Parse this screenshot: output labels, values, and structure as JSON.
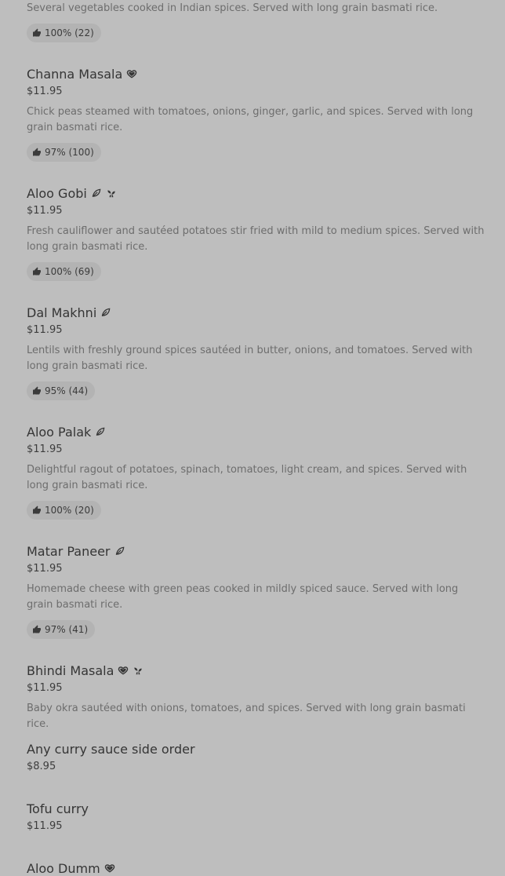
{
  "items": [
    {
      "description": "Several vegetables cooked in Indian spices. Served with long grain basmati rice.",
      "rating": "100% (22)"
    },
    {
      "name": "Channa Masala",
      "price": "$11.95",
      "description": "Chick peas steamed with tomatoes, onions, ginger, garlic, and spices. Served with long grain basmati rice.",
      "rating": "97% (100)",
      "tags": [
        "heart-icon"
      ]
    },
    {
      "name": "Aloo Gobi",
      "price": "$11.95",
      "description": "Fresh cauliflower and sautéed potatoes stir fried with mild to medium spices. Served with long grain basmati rice.",
      "rating": "100% (69)",
      "tags": [
        "leaf-icon",
        "sprout-icon"
      ]
    },
    {
      "name": "Dal Makhni",
      "price": "$11.95",
      "description": "Lentils with freshly ground spices sautéed in butter, onions, and tomatoes. Served with long grain basmati rice.",
      "rating": "95% (44)",
      "tags": [
        "leaf-icon"
      ]
    },
    {
      "name": "Aloo Palak",
      "price": "$11.95",
      "description": "Delightful ragout of potatoes, spinach, tomatoes, light cream, and spices. Served with long grain basmati rice.",
      "rating": "100% (20)",
      "tags": [
        "leaf-icon"
      ]
    },
    {
      "name": "Matar Paneer",
      "price": "$11.95",
      "description": "Homemade cheese with green peas cooked in mildly spiced sauce. Served with long grain basmati rice.",
      "rating": "97% (41)",
      "tags": [
        "leaf-icon"
      ]
    },
    {
      "name": "Bhindi Masala",
      "price": "$11.95",
      "description": "Baby okra sautéed with onions, tomatoes, and spices. Served with long grain basmati rice.",
      "tags": [
        "heart-icon",
        "sprout-icon"
      ]
    },
    {
      "name": "Any curry sauce side order",
      "price": "$8.95"
    },
    {
      "name": "Tofu curry",
      "price": "$11.95"
    },
    {
      "name": "Aloo Dumm",
      "tags": [
        "heart-icon"
      ]
    }
  ],
  "icons": {
    "rating": "thumbs-up-icon"
  },
  "colors": {
    "background": "#bebebe",
    "badge": "#b3b3b3",
    "text": "#353535",
    "muted": "#6d6d6d"
  }
}
